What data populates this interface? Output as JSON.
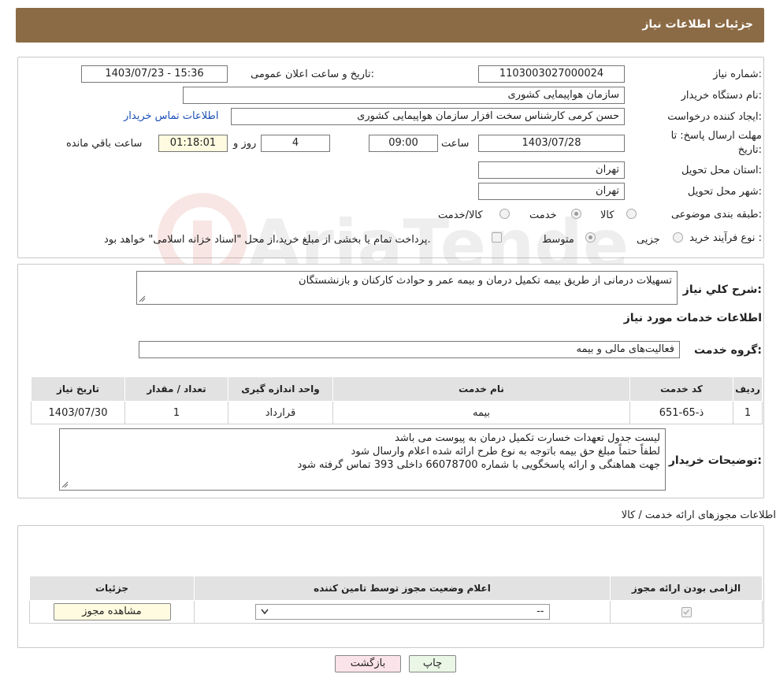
{
  "header": {
    "title": "جزئیات اطلاعات نیاز"
  },
  "need_info": {
    "need_number_label": "شماره نیاز:",
    "need_number": "1103003027000024",
    "announce_label": "تاریخ و ساعت اعلان عمومی:",
    "announce_value": "1403/07/23 - 15:36",
    "buyer_org_label": "نام دستگاه خریدار:",
    "buyer_org": "سازمان هواپیمایی کشوری",
    "creator_label": "ایجاد کننده درخواست:",
    "creator": "حسن کرمی کارشناس سخت افزار سازمان هواپیمایی کشوری",
    "contact_link": "اطلاعات تماس خریدار",
    "deadline_label_1": "مهلت ارسال پاسخ: تا",
    "deadline_label_2": "تاریخ:",
    "deadline_date": "1403/07/28",
    "time_label": "ساعت",
    "deadline_time": "09:00",
    "days_value": "4",
    "days_label": "روز و",
    "remaining_value": "01:18:01",
    "remaining_label": "ساعت باقي مانده",
    "province_label": "استان محل تحویل:",
    "province": "تهران",
    "city_label": "شهر محل تحویل:",
    "city": "تهران",
    "category_label": "طبقه بندی موضوعی:",
    "category_options": [
      "کالا",
      "خدمت",
      "کالا/خدمت"
    ],
    "category_selected": "خدمت",
    "process_label": "نوع فرآیند خرید :",
    "process_options": [
      "جزیی",
      "متوسط"
    ],
    "payment_note": "پرداخت تمام یا بخشی از مبلغ خرید،از محل \"اسناد خزانه اسلامی\" خواهد بود."
  },
  "watermark": {
    "text": "AriaTender.neT"
  },
  "description": {
    "summary_label": "شرح کلي نياز:",
    "summary": "تسهیلات درمانی از طریق بیمه تکمیل درمان و بیمه عمر و حوادث کارکنان و بازنشستگان",
    "services_title": "اطلاعات خدمات مورد نیاز",
    "service_group_label": "گروه خدمت:",
    "service_group": "فعالیت‌های مالی و بیمه"
  },
  "services_table": {
    "headers": [
      "ردیف",
      "کد خدمت",
      "نام خدمت",
      "واحد اندازه گیری",
      "تعداد / مقدار",
      "تاریخ نیاز"
    ],
    "rows": [
      [
        "1",
        "ذ-65-651",
        "بیمه",
        "قرارداد",
        "1",
        "1403/07/30"
      ]
    ]
  },
  "buyer_notes": {
    "label": "توضیحات خریدار:",
    "lines": [
      "لیست جدول تعهدات خسارت تکمیل درمان به پیوست می باشد",
      "لطفاً حتماً مبلغ حق بیمه باتوجه به نوع طرح ارائه شده اعلام وارسال شود",
      "جهت هماهنگی و ارائه پاسخگویی با شماره 66078700 داخلی 393 تماس گرفته شود"
    ]
  },
  "permits": {
    "title": "اطلاعات مجوزهای ارائه خدمت / کالا",
    "headers": [
      "الزامی بودن ارائه مجوز",
      "اعلام وضعیت مجوز توسط تامین کننده",
      "جزئیات"
    ],
    "select_value": "--",
    "view_button": "مشاهده مجوز"
  },
  "footer": {
    "print_button": "چاپ",
    "back_button": "بازگشت"
  },
  "colors": {
    "header_bg": "#8b6b45",
    "link": "#1a4fb5",
    "back_button_bg": "#fbe3ea",
    "print_button_bg": "#eaf6e6",
    "view_button_bg": "#fffbe0"
  }
}
